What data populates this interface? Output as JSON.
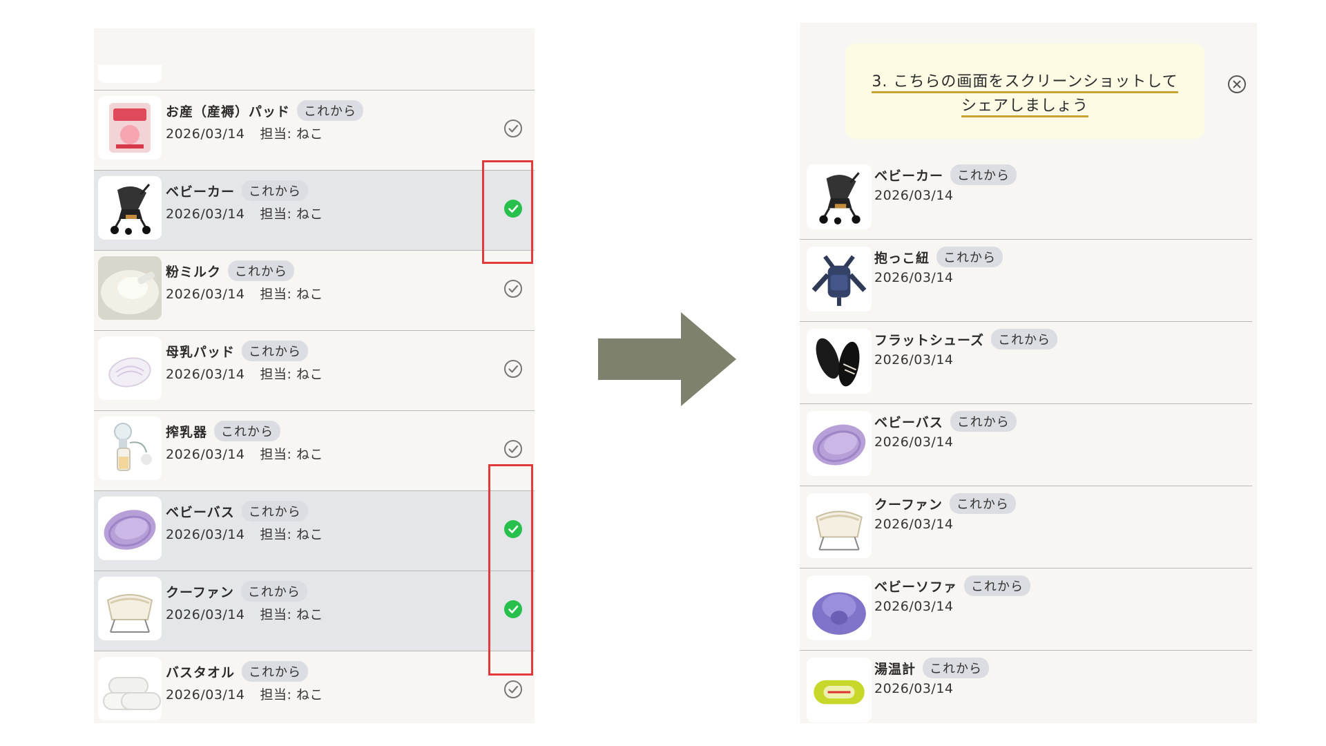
{
  "left_list": {
    "items": [
      {
        "name": "お産（産褥）パッド",
        "status": "これから",
        "date": "2026/03/14",
        "assignee": "担当: ねこ",
        "checked": false,
        "icon": "pad-package-icon"
      },
      {
        "name": "ベビーカー",
        "status": "これから",
        "date": "2026/03/14",
        "assignee": "担当: ねこ",
        "checked": true,
        "icon": "stroller-icon"
      },
      {
        "name": "粉ミルク",
        "status": "これから",
        "date": "2026/03/14",
        "assignee": "担当: ねこ",
        "checked": false,
        "icon": "milk-powder-icon"
      },
      {
        "name": "母乳パッド",
        "status": "これから",
        "date": "2026/03/14",
        "assignee": "担当: ねこ",
        "checked": false,
        "icon": "nursing-pad-icon"
      },
      {
        "name": "搾乳器",
        "status": "これから",
        "date": "2026/03/14",
        "assignee": "担当: ねこ",
        "checked": false,
        "icon": "breast-pump-icon"
      },
      {
        "name": "ベビーバス",
        "status": "これから",
        "date": "2026/03/14",
        "assignee": "担当: ねこ",
        "checked": true,
        "icon": "baby-bath-icon"
      },
      {
        "name": "クーファン",
        "status": "これから",
        "date": "2026/03/14",
        "assignee": "担当: ねこ",
        "checked": true,
        "icon": "bassinet-icon"
      },
      {
        "name": "バスタオル",
        "status": "これから",
        "date": "2026/03/14",
        "assignee": "担当: ねこ",
        "checked": false,
        "icon": "towel-icon"
      }
    ]
  },
  "right_panel": {
    "banner": {
      "line1": "3. こちらの画面をスクリーンショットして",
      "line2": "シェアしましょう"
    },
    "items": [
      {
        "name": "ベビーカー",
        "status": "これから",
        "date": "2026/03/14",
        "icon": "stroller-icon"
      },
      {
        "name": "抱っこ紐",
        "status": "これから",
        "date": "2026/03/14",
        "icon": "baby-carrier-icon"
      },
      {
        "name": "フラットシューズ",
        "status": "これから",
        "date": "2026/03/14",
        "icon": "flat-shoes-icon"
      },
      {
        "name": "ベビーバス",
        "status": "これから",
        "date": "2026/03/14",
        "icon": "baby-bath-icon"
      },
      {
        "name": "クーファン",
        "status": "これから",
        "date": "2026/03/14",
        "icon": "bassinet-icon"
      },
      {
        "name": "ベビーソファ",
        "status": "これから",
        "date": "2026/03/14",
        "icon": "baby-sofa-icon"
      },
      {
        "name": "湯温計",
        "status": "これから",
        "date": "2026/03/14",
        "icon": "bath-thermometer-icon"
      }
    ]
  },
  "colors": {
    "check_green": "#27c04d",
    "highlight_red": "#e23a3a",
    "arrow": "#7e826c",
    "banner_underline": "#c9a232"
  }
}
